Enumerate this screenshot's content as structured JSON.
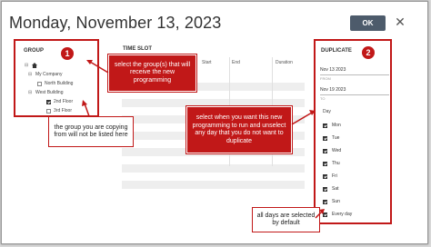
{
  "dialog": {
    "title": "Monday, November 13, 2023",
    "ok_label": "OK",
    "close_glyph": "✕"
  },
  "group": {
    "header": "GROUP",
    "badge": "1",
    "tree": [
      {
        "label": "",
        "icon": "home-icon",
        "expander": "⊟"
      },
      {
        "label": "My Company",
        "expander": "⊟"
      },
      {
        "label": "North Building",
        "checked": false
      },
      {
        "label": "West Building",
        "expander": "⊟"
      },
      {
        "label": "2nd Floor",
        "checked": true
      },
      {
        "label": "3rd Floor",
        "checked": false
      }
    ]
  },
  "time_slot": {
    "header": "TIME SLOT",
    "columns": [
      "Start",
      "End",
      "Duration"
    ]
  },
  "duplicate": {
    "header": "DUPLICATE",
    "badge": "2",
    "from_date": "Nov 13 2023",
    "from_label": "FROM",
    "to_date": "Nov 19 2023",
    "to_label": "TO",
    "day_label": "Day",
    "days": [
      {
        "label": "Mon",
        "checked": true
      },
      {
        "label": "Tue",
        "checked": true
      },
      {
        "label": "Wed",
        "checked": true
      },
      {
        "label": "Thu",
        "checked": true
      },
      {
        "label": "Fri",
        "checked": true
      },
      {
        "label": "Sat",
        "checked": true
      },
      {
        "label": "Sun",
        "checked": true
      },
      {
        "label": "Every day",
        "checked": true
      }
    ]
  },
  "callouts": {
    "select_groups": "select the group(s) that will receive the new programming",
    "copying_from": "the group you are copying from will not be listed here",
    "select_when": "select when you want this new programming to run and unselect any day that you do not want to duplicate",
    "all_days": "all days are selected by default"
  },
  "colors": {
    "accent_red": "#c11818",
    "ok_button": "#4d5b6b"
  }
}
